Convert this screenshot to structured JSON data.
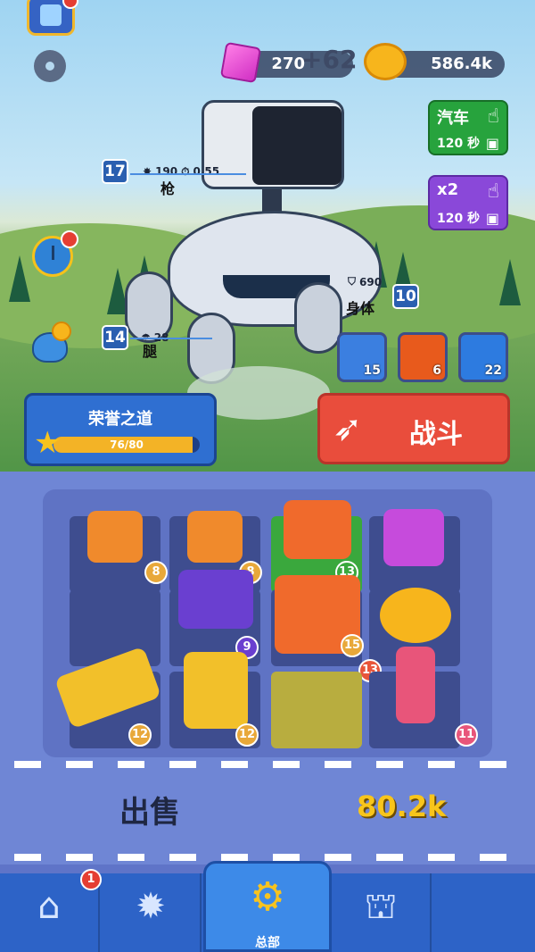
{
  "hud": {
    "gems": "270",
    "gem_gain": "+62",
    "gold": "586.4k"
  },
  "boosts": [
    {
      "title": "汽车",
      "duration": "120 秒"
    },
    {
      "title": "x2",
      "duration": "120 秒"
    }
  ],
  "robot_parts": {
    "gun": {
      "level": "17",
      "damage": "190",
      "rate": "0.55",
      "name": "枪"
    },
    "body": {
      "level": "10",
      "armor": "690",
      "name": "身体"
    },
    "legs": {
      "level": "14",
      "speed": "28",
      "name": "腿"
    }
  },
  "skills": [
    {
      "name": "shield-skill",
      "count": "15",
      "color": "#3b7fe0"
    },
    {
      "name": "fire-skill",
      "count": "6",
      "color": "#e85a1c"
    },
    {
      "name": "lightning-skill",
      "count": "22",
      "color": "#2d7be0"
    }
  ],
  "honor": {
    "title": "荣誉之道",
    "progress_text": "76/80",
    "progress": 0.95
  },
  "battle": {
    "label": "战斗"
  },
  "grid": {
    "row1": [
      {
        "level": "8",
        "color": "#f08a2c"
      },
      {
        "level": "8",
        "color": "#f08a2c"
      },
      {
        "level": "13",
        "color": "#f06a2c"
      },
      {
        "level": "",
        "color": "#c64bdc"
      }
    ],
    "row2": [
      {
        "level": "",
        "color": ""
      },
      {
        "level": "9",
        "color": "#6a3fd0"
      },
      {
        "level": "15",
        "color": "#f06a2c"
      },
      {
        "level": "",
        "color": "#f7b51c"
      }
    ],
    "row3": [
      {
        "level": "12",
        "color": "#f2c02a"
      },
      {
        "level": "12",
        "color": "#f2c02a"
      },
      {
        "level": "",
        "color": ""
      },
      {
        "level": "11",
        "color": "#e8557a"
      }
    ],
    "floating_level": "13"
  },
  "sell": {
    "label": "出售",
    "value": "80.2k"
  },
  "nav": {
    "shop_badge": "1",
    "active_label": "总部"
  }
}
